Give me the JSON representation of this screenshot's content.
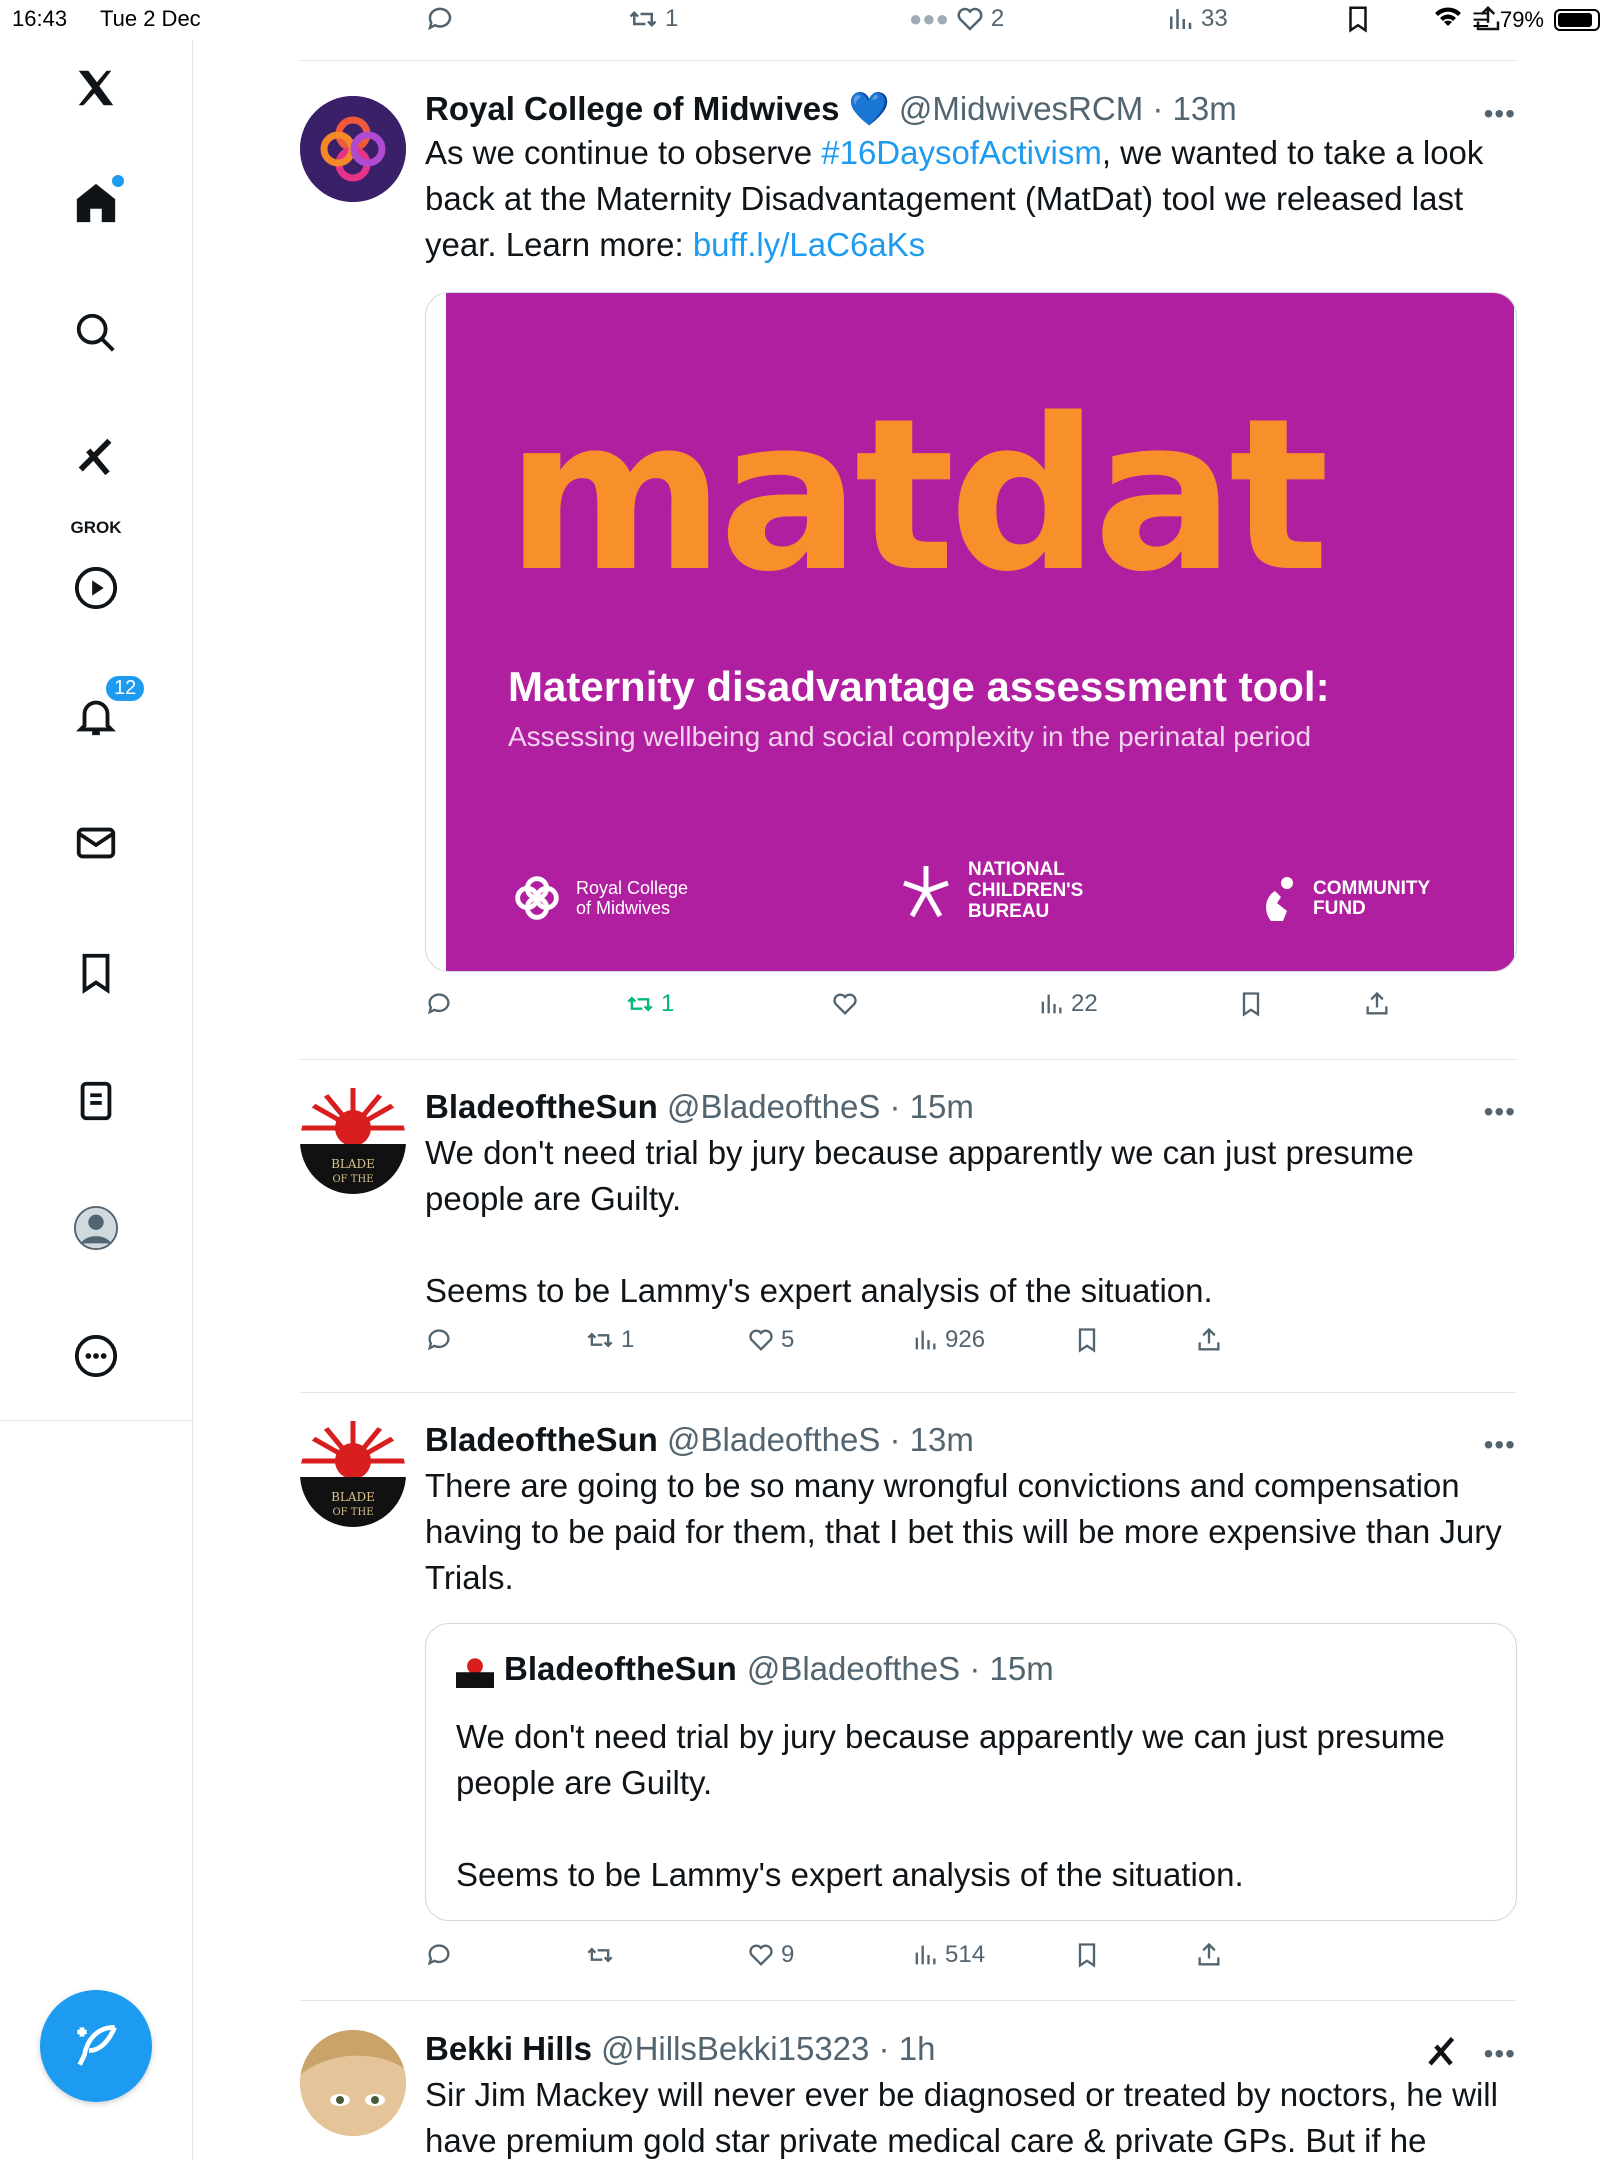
{
  "status": {
    "time": "16:43",
    "date": "Tue 2 Dec",
    "battery": "79%"
  },
  "top_actions": {
    "retweets": "1",
    "likes": "2",
    "views": "33"
  },
  "sidebar": {
    "grok_label": "GROK",
    "notifications_count": "12"
  },
  "tweets": [
    {
      "name": "Royal College of Midwives",
      "handle": "@MidwivesRCM",
      "time": "13m",
      "text_before": "As we continue to observe ",
      "hashtag": "#16DaysofActivism",
      "text_after": ", we wanted to take a look back at the Maternity Disadvantagement (MatDat) tool we released last year. Learn more: ",
      "link": "buff.ly/LaC6aKs",
      "media": {
        "logo_text": "matdat",
        "headline": "Maternity disadvantage assessment tool:",
        "subheadline": "Assessing wellbeing and social complexity in the perinatal period",
        "partner1": "Royal College of Midwives",
        "partner2_line1": "NATIONAL",
        "partner2_line2": "CHILDREN'S",
        "partner2_line3": "BUREAU",
        "partner3_line1": "COMMUNITY",
        "partner3_line2": "FUND"
      },
      "actions": {
        "retweets": "1",
        "likes": "",
        "views": "22"
      }
    },
    {
      "name": "BladeoftheSun",
      "handle": "@BladeoftheS",
      "time": "15m",
      "text_para1": "We don't need trial by jury because apparently we can just presume people are Guilty.",
      "text_para2": "Seems to be Lammy's expert analysis of the situation.",
      "actions": {
        "retweets": "1",
        "likes": "5",
        "views": "926"
      }
    },
    {
      "name": "BladeoftheSun",
      "handle": "@BladeoftheS",
      "time": "13m",
      "text": "There are going to be so many wrongful convictions and compensation having to be paid for them, that I bet this will be more expensive than Jury Trials.",
      "quote": {
        "name": "BladeoftheSun",
        "handle": "@BladeoftheS",
        "time": "15m",
        "text_para1": "We don't need trial by jury because apparently we can just presume people are Guilty.",
        "text_para2": "Seems to be Lammy's expert analysis of the situation."
      },
      "actions": {
        "retweets": "",
        "likes": "9",
        "views": "514"
      }
    },
    {
      "name": "Bekki Hills",
      "handle": "@HillsBekki15323",
      "time": "1h",
      "text": "Sir Jim Mackey will never ever be diagnosed or treated by noctors, he will have premium gold star private medical care & private GPs. But if he"
    }
  ]
}
